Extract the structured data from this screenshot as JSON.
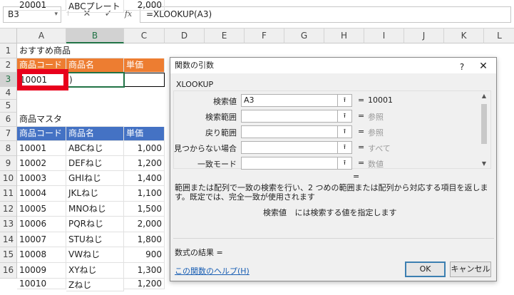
{
  "formula_bar": {
    "name_box": "B3",
    "name_box_arrow": "▾",
    "separator": "⁝",
    "cancel_glyph": "✕",
    "enter_glyph": "✓",
    "fx_glyph": "fx",
    "formula": "=XLOOKUP(A3)"
  },
  "columns": [
    "A",
    "B",
    "C",
    "D",
    "E",
    "F",
    "G",
    "H",
    "I",
    "J",
    "K",
    "L"
  ],
  "rows": [
    "1",
    "2",
    "3",
    "4",
    "5",
    "6",
    "7",
    "8",
    "9",
    "10",
    "11",
    "12",
    "13"
  ],
  "cells": {
    "a1": "おすすめ商品",
    "a2": "商品コード",
    "b2": "商品名",
    "c2": "単価",
    "a3": "10001",
    "b3": ")",
    "a6": "商品マスタ",
    "a7": "商品コード",
    "b7": "商品名",
    "c7": "単価",
    "master": [
      {
        "code": "10001",
        "name": "ABCねじ",
        "price": "1,000"
      },
      {
        "code": "10002",
        "name": "DEFねじ",
        "price": "1,200"
      },
      {
        "code": "10003",
        "name": "GHIねじ",
        "price": "1,400"
      },
      {
        "code": "10004",
        "name": "JKLねじ",
        "price": "1,100"
      },
      {
        "code": "10005",
        "name": "MNOねじ",
        "price": "1,500"
      },
      {
        "code": "10006",
        "name": "PQRねじ",
        "price": "2,000"
      },
      {
        "code": "10007",
        "name": "STUねじ",
        "price": "1,800"
      },
      {
        "code": "10008",
        "name": "VWねじ",
        "price": "900"
      },
      {
        "code": "10009",
        "name": "XYねじ",
        "price": "1,300"
      },
      {
        "code": "10010",
        "name": "Zねじ",
        "price": "1,200"
      },
      {
        "code": "20001",
        "name": "ABCプレート",
        "price": "2,000"
      }
    ]
  },
  "dialog": {
    "title": "関数の引数",
    "help": "?",
    "close": "✕",
    "function_name": "XLOOKUP",
    "ref_glyph": "⭱",
    "eq": "=",
    "args": [
      {
        "label": "検索値",
        "value": "A3",
        "result": "10001",
        "muted": false
      },
      {
        "label": "検索範囲",
        "value": "",
        "result": "参照",
        "muted": true
      },
      {
        "label": "戻り範囲",
        "value": "",
        "result": "参照",
        "muted": true
      },
      {
        "label": "見つからない場合",
        "value": "",
        "result": "すべて",
        "muted": true
      },
      {
        "label": "一致モード",
        "value": "",
        "result": "数値",
        "muted": true
      }
    ],
    "result_eq": "=",
    "description": "範囲または配列で一致の検索を行い、2 つめの範囲または配列から対応する項目を返します。既定では、完全一致が使用されます",
    "arg_desc_name": "検索値",
    "arg_desc_text": "には検索する値を指定します",
    "formula_result": "数式の結果 =",
    "help_link": "この関数のヘルプ(H)",
    "ok": "OK",
    "cancel": "キャンセル"
  },
  "colors": {
    "orange_header": "#ed7d31",
    "blue_header": "#4472c4",
    "selection": "#217346",
    "highlight_red": "#e8001c"
  }
}
